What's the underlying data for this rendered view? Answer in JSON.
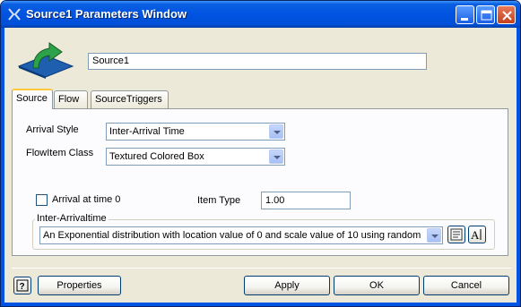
{
  "window": {
    "title": "Source1  Parameters Window",
    "buttons": [
      "minimize",
      "maximize",
      "close"
    ]
  },
  "header": {
    "name_value": "Source1",
    "logo_icon": "source-arrow-icon"
  },
  "tabs": [
    {
      "label": "Source",
      "active": true
    },
    {
      "label": "Flow",
      "active": false
    },
    {
      "label": "SourceTriggers",
      "active": false
    }
  ],
  "source_tab": {
    "arrival_style_label": "Arrival Style",
    "arrival_style_value": "Inter-Arrival Time",
    "flowitem_class_label": "FlowItem Class",
    "flowitem_class_value": "Textured Colored Box",
    "arrival_at_time0_label": "Arrival at time 0",
    "arrival_at_time0_checked": false,
    "item_type_label": "Item Type",
    "item_type_value": "1.00",
    "interarrival_group_label": "Inter-Arrivaltime",
    "interarrival_value": "An Exponential distribution with location value of 0   and scale value of 10   using random"
  },
  "footer": {
    "properties_label": "Properties",
    "apply_label": "Apply",
    "ok_label": "OK",
    "cancel_label": "Cancel"
  },
  "colors": {
    "titlebar": "#0054e3",
    "dialog_bg": "#ece9d8",
    "tab_accent": "#ffc83c"
  }
}
